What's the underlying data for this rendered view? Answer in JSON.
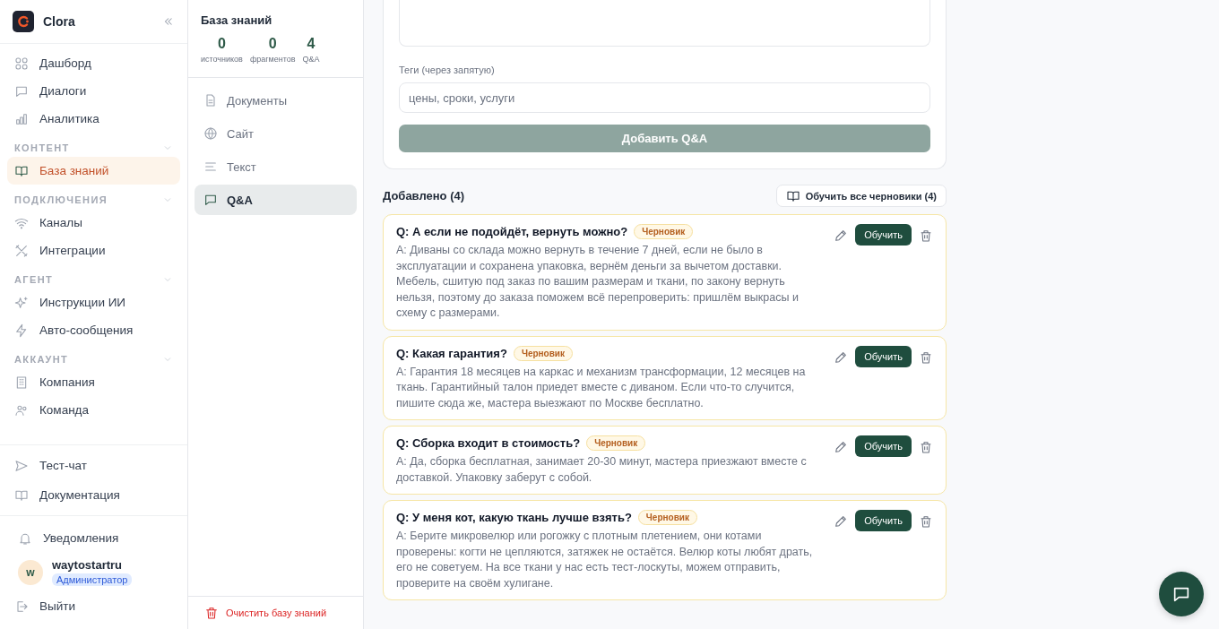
{
  "app": {
    "name": "Clora"
  },
  "sidebar": {
    "groups": [
      {
        "items": [
          {
            "label": "Дашборд",
            "selected": false
          },
          {
            "label": "Диалоги",
            "selected": false
          },
          {
            "label": "Аналитика",
            "selected": false
          }
        ]
      },
      {
        "title": "КОНТЕНТ",
        "items": [
          {
            "label": "База знаний",
            "selected": true
          }
        ]
      },
      {
        "title": "ПОДКЛЮЧЕНИЯ",
        "items": [
          {
            "label": "Каналы",
            "selected": false
          },
          {
            "label": "Интеграции",
            "selected": false
          }
        ]
      },
      {
        "title": "АГЕНТ",
        "items": [
          {
            "label": "Инструкции ИИ",
            "selected": false
          },
          {
            "label": "Авто-сообщения",
            "selected": false
          }
        ]
      },
      {
        "title": "АККАУНТ",
        "items": [
          {
            "label": "Компания",
            "selected": false
          },
          {
            "label": "Команда",
            "selected": false
          }
        ]
      }
    ],
    "links": [
      "Тест-чат",
      "Документация"
    ],
    "notifications": "Уведомления",
    "user": {
      "initial": "w",
      "name": "waytostartru",
      "role": "Администратор"
    },
    "logout": "Выйти"
  },
  "knowledge": {
    "title": "База знаний",
    "stats": [
      {
        "value": "0",
        "label": "источников"
      },
      {
        "value": "0",
        "label": "фрагментов"
      },
      {
        "value": "4",
        "label": "Q&A"
      }
    ],
    "tabs": [
      {
        "label": "Документы",
        "selected": false
      },
      {
        "label": "Сайт",
        "selected": false
      },
      {
        "label": "Текст",
        "selected": false
      },
      {
        "label": "Q&A",
        "selected": true
      }
    ],
    "clear": "Очистить базу знаний"
  },
  "form": {
    "tags_label": "Теги (через запятую)",
    "tags_placeholder": "цены, сроки, услуги",
    "submit": "Добавить Q&A",
    "submit_disabled": true
  },
  "added": {
    "title": "Добавлено (4)",
    "train_all": "Обучить все черновики (4)"
  },
  "qa": [
    {
      "question": "Q: А если не подойдёт, вернуть можно?",
      "status": "Черновик",
      "answer": "А: Диваны со склада можно вернуть в течение 7 дней, если не было в эксплуатации и сохранена упаковка, вернём деньги за вычетом доставки. Мебель, сшитую под заказ по вашим размерам и ткани, по закону вернуть нельзя, поэтому до заказа поможем всё перепроверить: пришлём выкрасы и схему с размерами.",
      "train": "Обучить"
    },
    {
      "question": "Q: Какая гарантия?",
      "status": "Черновик",
      "answer": "А: Гарантия 18 месяцев на каркас и механизм трансформации, 12 месяцев на ткань. Гарантийный талон приедет вместе с диваном. Если что-то случится, пишите сюда же, мастера выезжают по Москве бесплатно.",
      "train": "Обучить"
    },
    {
      "question": "Q: Сборка входит в стоимость?",
      "status": "Черновик",
      "answer": "А: Да, сборка бесплатная, занимает 20-30 минут, мастера приезжают вместе с доставкой. Упаковку заберут с собой.",
      "train": "Обучить"
    },
    {
      "question": "Q: У меня кот, какую ткань лучше взять?",
      "status": "Черновик",
      "answer": "А: Берите микровелюр или рогожку с плотным плетением, они котами проверены: когти не цепляются, затяжек не остаётся. Велюр коты любят драть, его не советуем. На все ткани у нас есть тест-лоскуты, можем отправить, проверите на своём хулигане.",
      "train": "Обучить"
    }
  ]
}
